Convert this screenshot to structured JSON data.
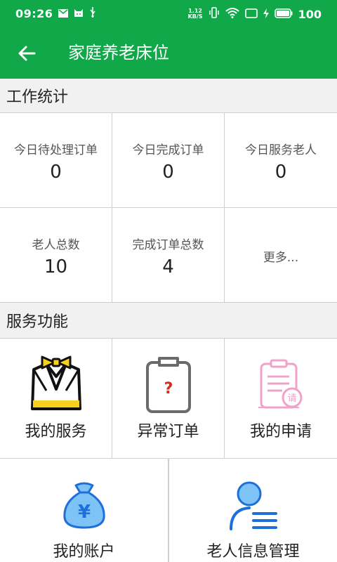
{
  "status_bar": {
    "time": "09:26",
    "net_speed_value": "1.12",
    "net_speed_unit": "KB/S",
    "battery": "100"
  },
  "app_bar": {
    "title": "家庭养老床位"
  },
  "stats_section": {
    "title": "工作统计",
    "items": [
      {
        "label": "今日待处理订单",
        "value": "0"
      },
      {
        "label": "今日完成订单",
        "value": "0"
      },
      {
        "label": "今日服务老人",
        "value": "0"
      },
      {
        "label": "老人总数",
        "value": "10"
      },
      {
        "label": "完成订单总数",
        "value": "4"
      }
    ],
    "more_label": "更多..."
  },
  "functions_section": {
    "title": "服务功能",
    "items": [
      {
        "label": "我的服务",
        "icon": "tuxedo-icon"
      },
      {
        "label": "异常订单",
        "icon": "clipboard-question-icon"
      },
      {
        "label": "我的申请",
        "icon": "application-clipboard-icon"
      },
      {
        "label": "我的账户",
        "icon": "money-bag-icon"
      },
      {
        "label": "老人信息管理",
        "icon": "user-list-icon"
      }
    ]
  },
  "colors": {
    "primary": "#11a84a",
    "section_bg": "#f1f1f1",
    "divider": "#cfcfcf",
    "icon_yellow": "#f7d21c",
    "icon_blue": "#1e6fd9",
    "icon_light_blue": "#7ec3f5",
    "icon_pink": "#f0a3c8",
    "icon_red": "#d62a1a"
  }
}
